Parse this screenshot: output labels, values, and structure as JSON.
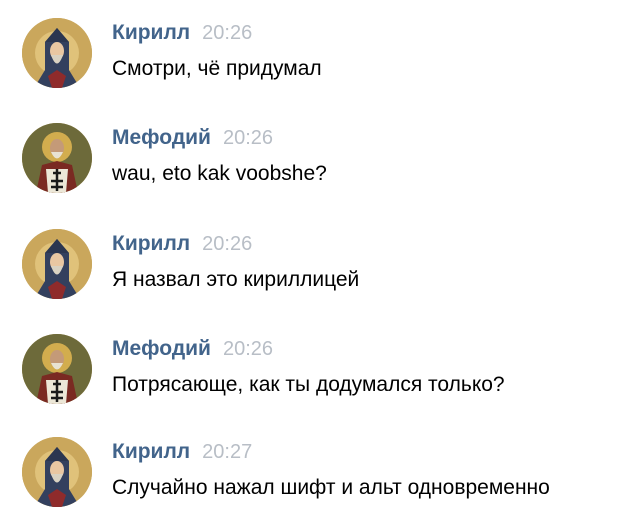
{
  "messages": [
    {
      "author": "Кирилл",
      "time": "20:26",
      "text": "Смотри, чё придумал",
      "avatar": "monk-icon"
    },
    {
      "author": "Мефодий",
      "time": "20:26",
      "text": "wau, eto kak voobshe?",
      "avatar": "bishop-icon"
    },
    {
      "author": "Кирилл",
      "time": "20:26",
      "text": "Я назвал это кириллицей",
      "avatar": "monk-icon"
    },
    {
      "author": "Мефодий",
      "time": "20:26",
      "text": "Потрясающе, как ты додумался только?",
      "avatar": "bishop-icon"
    },
    {
      "author": "Кирилл",
      "time": "20:27",
      "text": "Случайно нажал шифт и альт одновременно",
      "avatar": "monk-icon"
    }
  ],
  "colors": {
    "author": "#42648b",
    "time": "#b8bec6",
    "text": "#000000",
    "background": "#ffffff"
  }
}
